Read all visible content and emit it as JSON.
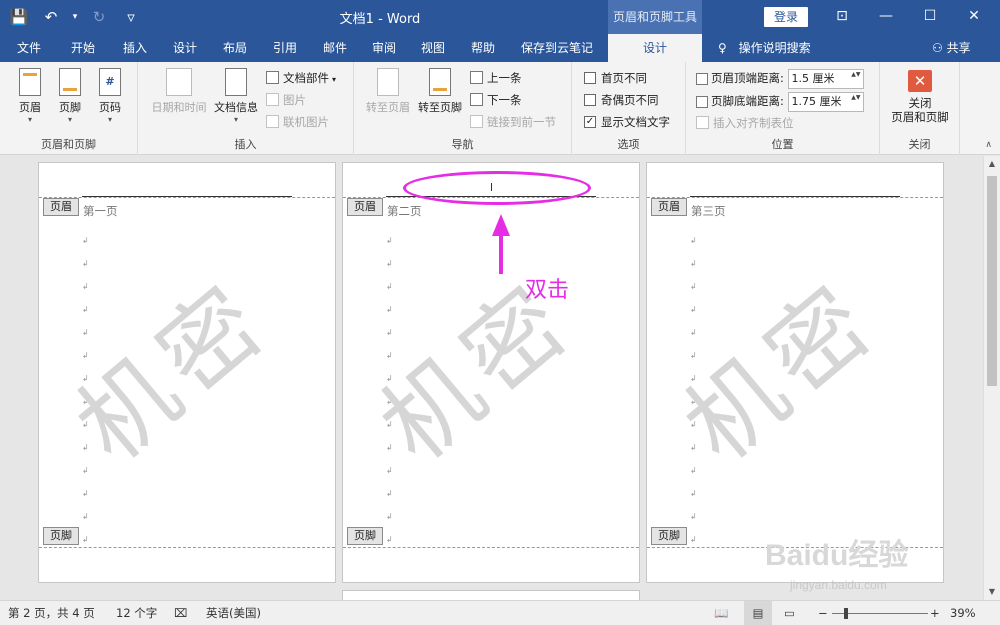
{
  "titlebar": {
    "title": "文档1  -  Word",
    "context_tools": "页眉和页脚工具",
    "login": "登录",
    "save_icon": "💾",
    "undo_icon": "↶",
    "undo_caret": "▾",
    "redo_icon": "↻",
    "customize_icon": "▿",
    "ribbon_display_icon": "⊡",
    "minimize_icon": "—",
    "maximize_icon": "☐",
    "close_icon": "✕"
  },
  "menu": {
    "tabs": [
      "文件",
      "开始",
      "插入",
      "设计",
      "布局",
      "引用",
      "邮件",
      "审阅",
      "视图",
      "帮助",
      "保存到云笔记",
      "设计"
    ],
    "active_tab_index": 11,
    "help_icon": "♀",
    "help_search": "操作说明搜索",
    "share_icon": "⚇",
    "share": "共享"
  },
  "ribbon": {
    "header_footer": {
      "label": "页眉和页脚",
      "header": "页眉",
      "footer": "页脚",
      "page_number": "页码",
      "caret": "▾"
    },
    "insert": {
      "label": "插入",
      "datetime": "日期和时间",
      "docinfo": "文档信息",
      "quick_parts": "文档部件",
      "picture": "图片",
      "online_picture": "联机图片"
    },
    "navigation": {
      "label": "导航",
      "goto_header": "转至页眉",
      "goto_footer": "转至页脚",
      "previous": "上一条",
      "next": "下一条",
      "link_previous": "链接到前一节"
    },
    "options": {
      "label": "选项",
      "first_page": "首页不同",
      "odd_even": "奇偶页不同",
      "show_text": "显示文档文字",
      "first_page_checked": false,
      "odd_even_checked": false,
      "show_text_checked": true,
      "check_mark": "✓"
    },
    "position": {
      "label": "位置",
      "header_top": "页眉顶端距离:",
      "header_top_value": "1.5 厘米",
      "footer_bottom": "页脚底端距离:",
      "footer_bottom_value": "1.75 厘米",
      "insert_tab": "插入对齐制表位",
      "spin_arrows": "▲▼"
    },
    "close": {
      "label": "关闭",
      "button_line1": "关闭",
      "button_line2": "页眉和页脚",
      "icon": "✕"
    }
  },
  "pages": [
    {
      "header_tag": "页眉",
      "footer_tag": "页脚",
      "text": "第一页",
      "watermark": "机密"
    },
    {
      "header_tag": "页眉",
      "footer_tag": "页脚",
      "text": "第二页",
      "watermark": "机密"
    },
    {
      "header_tag": "页眉",
      "footer_tag": "页脚",
      "text": "第三页",
      "watermark": "机密"
    }
  ],
  "paragraph_mark": "↲",
  "annotation": {
    "text": "双击",
    "color": "#e52de5"
  },
  "statusbar": {
    "page": "第 2 页，共 4 页",
    "words": "12 个字",
    "proofing_icon": "⌧",
    "language": "英语(美国)",
    "read_mode_icon": "📖",
    "print_layout_icon": "▤",
    "web_layout_icon": "▭",
    "zoom_out": "−",
    "zoom_in": "+",
    "zoom": "39%"
  },
  "scrollbar": {
    "up": "▲",
    "down": "▼"
  },
  "watermark_site": {
    "brand": "Baidu经验",
    "url": "jingyan.baidu.com"
  },
  "colors": {
    "accent": "#2b579a",
    "annotation": "#e52de5",
    "close_button": "#e05a3f"
  }
}
